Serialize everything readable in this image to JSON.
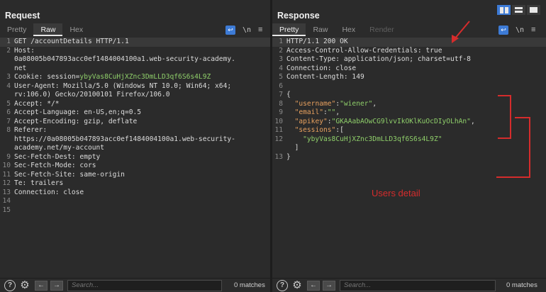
{
  "request": {
    "title": "Request",
    "tabs": [
      "Pretty",
      "Raw",
      "Hex"
    ],
    "active_tab": "Raw",
    "tools": {
      "newline": "\\n",
      "menu": "≡"
    },
    "lines": [
      {
        "n": "1",
        "text": "GET /accountDetails HTTP/1.1"
      },
      {
        "n": "2",
        "text": "Host:"
      },
      {
        "n": "",
        "text": "0a08005b047893acc0ef1484004100a1.web-security-academy."
      },
      {
        "n": "",
        "text": "net"
      },
      {
        "n": "3",
        "text": "Cookie: session=",
        "value": "ybyVas8CuHjXZnc3DmLLD3qf6S6s4L9Z"
      },
      {
        "n": "4",
        "text": "User-Agent: Mozilla/5.0 (Windows NT 10.0; Win64; x64;"
      },
      {
        "n": "",
        "text": "rv:106.0) Gecko/20100101 Firefox/106.0"
      },
      {
        "n": "5",
        "text": "Accept: */*"
      },
      {
        "n": "6",
        "text": "Accept-Language: en-US,en;q=0.5"
      },
      {
        "n": "7",
        "text": "Accept-Encoding: gzip, deflate"
      },
      {
        "n": "8",
        "text": "Referer:"
      },
      {
        "n": "",
        "text": "https://0a08005b047893acc0ef1484004100a1.web-security-"
      },
      {
        "n": "",
        "text": "academy.net/my-account"
      },
      {
        "n": "9",
        "text": "Sec-Fetch-Dest: empty"
      },
      {
        "n": "10",
        "text": "Sec-Fetch-Mode: cors"
      },
      {
        "n": "11",
        "text": "Sec-Fetch-Site: same-origin"
      },
      {
        "n": "12",
        "text": "Te: trailers"
      },
      {
        "n": "13",
        "text": "Connection: close"
      },
      {
        "n": "14",
        "text": ""
      },
      {
        "n": "15",
        "text": ""
      }
    ],
    "search_placeholder": "Search...",
    "matches": "0 matches"
  },
  "response": {
    "title": "Response",
    "tabs": [
      "Pretty",
      "Raw",
      "Hex",
      "Render"
    ],
    "active_tab": "Pretty",
    "tools": {
      "newline": "\\n",
      "menu": "≡"
    },
    "headers": [
      {
        "n": "1",
        "text": "HTTP/1.1 200 OK"
      },
      {
        "n": "2",
        "text": "Access-Control-Allow-Credentials: true"
      },
      {
        "n": "3",
        "text": "Content-Type: application/json; charset=utf-8"
      },
      {
        "n": "4",
        "text": "Connection: close"
      },
      {
        "n": "5",
        "text": "Content-Length: 149"
      },
      {
        "n": "6",
        "text": ""
      },
      {
        "n": "7",
        "text": "{"
      }
    ],
    "json_lines": [
      {
        "n": "8",
        "key": "\"username\"",
        "sep": ":",
        "str": "\"wiener\"",
        "end": ","
      },
      {
        "n": "9",
        "key": "\"email\"",
        "sep": ":",
        "str": "\"\"",
        "end": ","
      },
      {
        "n": "10",
        "key": "\"apikey\"",
        "sep": ":",
        "str": "\"GKAAabAOwCG9lvvIkOKlKuOcDIyOLhAn\"",
        "end": ","
      },
      {
        "n": "11",
        "key": "\"sessions\"",
        "sep": ":[",
        "str": "",
        "end": ""
      },
      {
        "n": "12",
        "key": "",
        "sep": "",
        "str": "\"ybyVas8CuHjXZnc3DmLLD3qf6S6s4L9Z\"",
        "end": ""
      },
      {
        "n": "",
        "key": "",
        "sep": "]",
        "str": "",
        "end": ""
      },
      {
        "n": "13",
        "key": "",
        "sep": "}",
        "str": "",
        "end": ""
      }
    ],
    "search_placeholder": "Search...",
    "matches": "0 matches"
  },
  "annotation": {
    "label": "Users detail",
    "color": "#d52c2c"
  },
  "accent": "#3d7bd6"
}
